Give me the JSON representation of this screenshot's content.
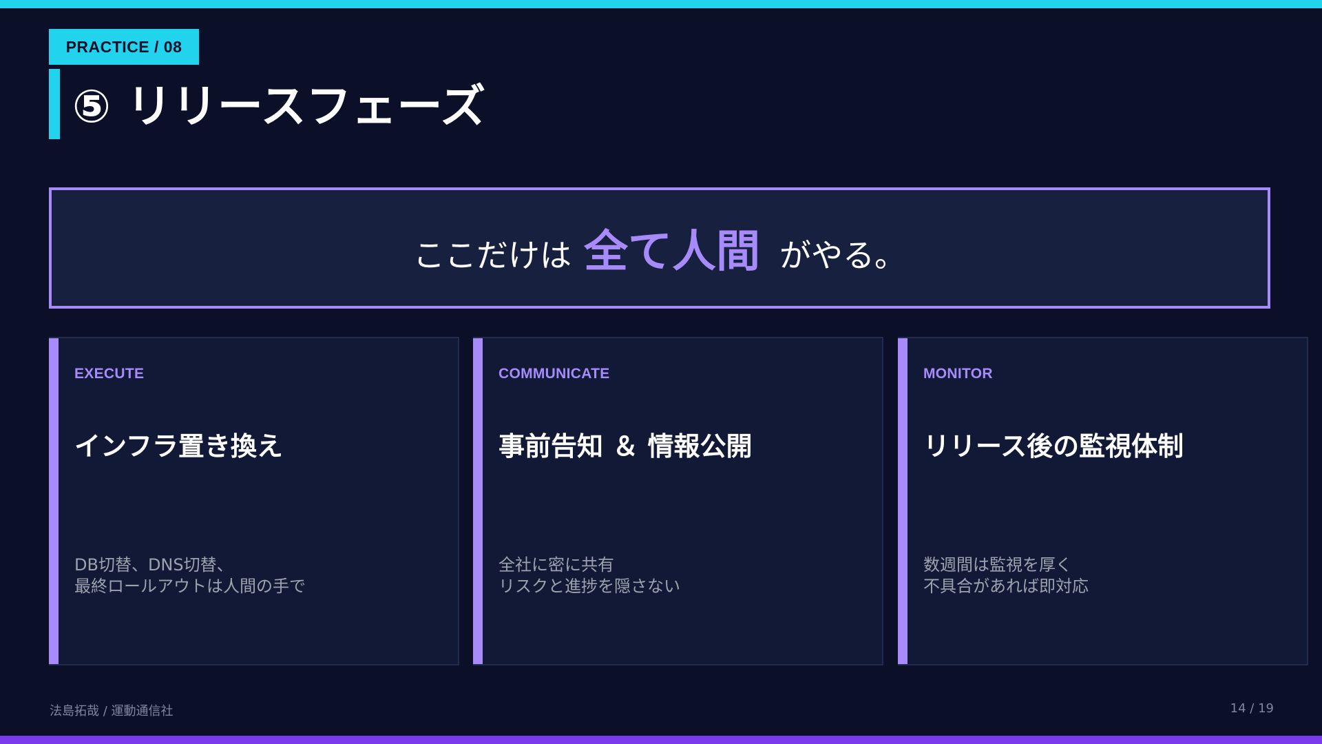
{
  "header": {
    "tag": "PRACTICE / 08",
    "title": "⑤ リリースフェーズ"
  },
  "hero": {
    "prefix": "ここだけは",
    "emphasis": "全て人間",
    "suffix": "がやる。"
  },
  "cards": [
    {
      "label": "EXECUTE",
      "title": "インフラ置き換え",
      "desc": [
        "DB切替、DNS切替、",
        "最終ロールアウトは人間の手で"
      ]
    },
    {
      "label": "COMMUNICATE",
      "title": "事前告知 ＆ 情報公開",
      "desc": [
        "全社に密に共有",
        "リスクと進捗を隠さない"
      ]
    },
    {
      "label": "MONITOR",
      "title": "リリース後の監視体制",
      "desc": [
        "数週間は監視を厚く",
        "不具合があれば即対応"
      ]
    }
  ],
  "footer": {
    "author": "法島拓哉 / 運動通信社",
    "page": "14 / 19"
  },
  "colors": {
    "background": "#0b1028",
    "cyan_accent": "#22d3ee",
    "purple_accent": "#a78bfa",
    "bottom_bar": "#7c3aed"
  }
}
